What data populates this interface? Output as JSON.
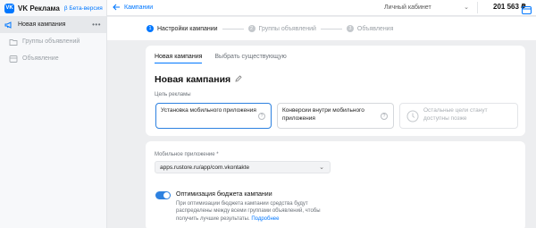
{
  "app": {
    "brand": "VK Реклама",
    "beta": "β Бета-версия"
  },
  "sidebar": {
    "items": [
      {
        "label": "Новая кампания",
        "more": "•••"
      },
      {
        "label": "Группы объявлений"
      },
      {
        "label": "Объявление"
      }
    ]
  },
  "header": {
    "back_label": "Кампании",
    "cabinet_label": "Личный кабинет",
    "balance": "201 563 ₽"
  },
  "steps": [
    {
      "num": "1",
      "label": "Настройки кампании"
    },
    {
      "num": "2",
      "label": "Группы объявлений"
    },
    {
      "num": "3",
      "label": "Объявления"
    }
  ],
  "campaign": {
    "tabs": [
      "Новая кампания",
      "Выбрать существующую"
    ],
    "title": "Новая кампания",
    "goal_label": "Цель рекламы",
    "goals": [
      {
        "label": "Установка мобильного приложения",
        "help": "?"
      },
      {
        "label": "Конверсии внутри мобильного приложения",
        "help": "?"
      },
      {
        "label": "Остальные цели станут доступны позже"
      }
    ]
  },
  "app_settings": {
    "field_label": "Мобильное приложение *",
    "field_value": "apps.rustore.ru/app/com.vkontakte",
    "toggle_label": "Оптимизация бюджета кампании",
    "toggle_description": "При оптимизации бюджета кампании средства будут распределены между всеми группами объявлений, чтобы получить лучшие результаты.",
    "more_link": "Подробнее",
    "toggle_on": true
  },
  "colors": {
    "accent": "#0077ff",
    "selected_border": "#2d81e0",
    "background": "#edeef0"
  }
}
